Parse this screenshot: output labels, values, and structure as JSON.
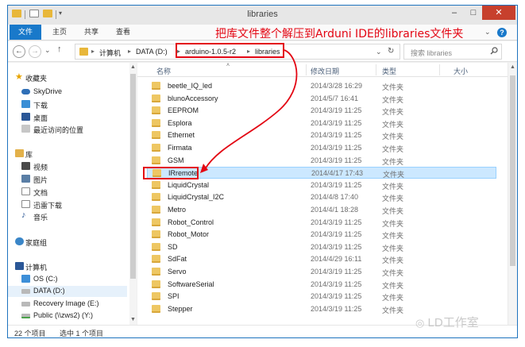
{
  "window": {
    "title": "libraries",
    "min_glyph": "–",
    "max_glyph": "□",
    "close_glyph": "✕"
  },
  "ribbon": {
    "tabs": [
      "文件",
      "主页",
      "共享",
      "查看"
    ],
    "expand_glyph": "⌄",
    "help_glyph": "?"
  },
  "address": {
    "back_glyph": "←",
    "forward_glyph": "→",
    "dropdown_glyph": "⌄",
    "up_glyph": "↑",
    "crumbs": [
      "计算机",
      "DATA (D:)",
      "arduino-1.0.5-r2",
      "libraries"
    ],
    "refresh_glyph": "↻",
    "history_glyph": "⌄",
    "search_placeholder": "搜索 libraries"
  },
  "columns": {
    "name": "名称",
    "modified": "修改日期",
    "type": "类型",
    "size": "大小"
  },
  "nav": {
    "favorites_label": "收藏夹",
    "favorites": [
      "SkyDrive",
      "下载",
      "桌面",
      "最近访问的位置"
    ],
    "library_label": "库",
    "libraries": [
      "视频",
      "图片",
      "文档",
      "迅雷下载",
      "音乐"
    ],
    "homegroup_label": "家庭组",
    "computer_label": "计算机",
    "drives": [
      "OS (C:)",
      "DATA (D:)",
      "Recovery Image (E:)",
      "Public (\\\\zws2) (Y:)"
    ]
  },
  "files": [
    {
      "name": "beetle_IQ_led",
      "date": "2014/3/28 16:29",
      "type": "文件夹"
    },
    {
      "name": "blunoAccessory",
      "date": "2014/5/7 16:41",
      "type": "文件夹"
    },
    {
      "name": "EEPROM",
      "date": "2014/3/19 11:25",
      "type": "文件夹"
    },
    {
      "name": "Esplora",
      "date": "2014/3/19 11:25",
      "type": "文件夹"
    },
    {
      "name": "Ethernet",
      "date": "2014/3/19 11:25",
      "type": "文件夹"
    },
    {
      "name": "Firmata",
      "date": "2014/3/19 11:25",
      "type": "文件夹"
    },
    {
      "name": "GSM",
      "date": "2014/3/19 11:25",
      "type": "文件夹"
    },
    {
      "name": "IRremote",
      "date": "2014/4/17 17:43",
      "type": "文件夹"
    },
    {
      "name": "LiquidCrystal",
      "date": "2014/3/19 11:25",
      "type": "文件夹"
    },
    {
      "name": "LiquidCrystal_I2C",
      "date": "2014/4/8 17:40",
      "type": "文件夹"
    },
    {
      "name": "Metro",
      "date": "2014/4/1 18:28",
      "type": "文件夹"
    },
    {
      "name": "Robot_Control",
      "date": "2014/3/19 11:25",
      "type": "文件夹"
    },
    {
      "name": "Robot_Motor",
      "date": "2014/3/19 11:25",
      "type": "文件夹"
    },
    {
      "name": "SD",
      "date": "2014/3/19 11:25",
      "type": "文件夹"
    },
    {
      "name": "SdFat",
      "date": "2014/4/29 16:11",
      "type": "文件夹"
    },
    {
      "name": "Servo",
      "date": "2014/3/19 11:25",
      "type": "文件夹"
    },
    {
      "name": "SoftwareSerial",
      "date": "2014/3/19 11:25",
      "type": "文件夹"
    },
    {
      "name": "SPI",
      "date": "2014/3/19 11:25",
      "type": "文件夹"
    },
    {
      "name": "Stepper",
      "date": "2014/3/19 11:25",
      "type": "文件夹"
    }
  ],
  "status": {
    "count": "22 个项目",
    "selected": "选中 1 个项目"
  },
  "annotation": {
    "text": "把库文件整个解压到Arduni IDE的libraries文件夹",
    "color": "#e30613"
  },
  "watermark": "LD工作室"
}
